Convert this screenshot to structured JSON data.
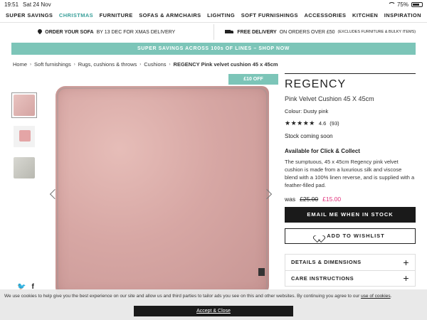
{
  "status_bar": {
    "time": "19:51",
    "date": "Sat 24 Nov",
    "battery": "75%",
    "battery_level": 0.75
  },
  "nav": {
    "items": [
      "SUPER SAVINGS",
      "CHRISTMAS",
      "FURNITURE",
      "SOFAS & ARMCHAIRS",
      "LIGHTING",
      "SOFT FURNISHINGS",
      "ACCESSORIES",
      "KITCHEN",
      "INSPIRATION"
    ],
    "active_color": "#3aa09a"
  },
  "delivery": {
    "left_bold": "ORDER YOUR SOFA",
    "left_text": "BY 13 DEC FOR XMAS DELIVERY",
    "right_bold": "FREE DELIVERY",
    "right_text": "ON ORDERS OVER £50",
    "right_small": "(EXCLUDES FURNITURE & BULKY ITEMS)"
  },
  "promo": {
    "text": "SUPER SAVINGS ACROSS 100s OF LINES – SHOP NOW",
    "color": "#7cc5b8"
  },
  "breadcrumb": [
    "Home",
    "Soft furnishings",
    "Rugs, cushions & throws",
    "Cushions",
    "REGENCY Pink velvet cushion 45 x 45cm"
  ],
  "gallery": {
    "sale_badge": "£10 OFF"
  },
  "product": {
    "brand": "REGENCY",
    "subtitle": "Pink Velvet Cushion 45 X 45cm",
    "colour": "Colour: Dusty pink",
    "stars": "★★★★★",
    "rating": "4.6",
    "review_count": "(93)",
    "stock": "Stock coming soon",
    "availability": "Available for Click & Collect",
    "description": "The sumptuous, 45 x 45cm Regency pink velvet cushion is made from a luxurious silk and viscose blend with a 100% linen reverse, and is supplied with a feather-filled pad.",
    "was_label": "was",
    "was_price": "£25.00",
    "now_price": "£15.00",
    "price_color": "#e0307a",
    "email_button": "EMAIL ME WHEN IN STOCK",
    "wishlist_button": "ADD TO WISHLIST",
    "accordion": [
      "DETAILS & DIMENSIONS",
      "CARE INSTRUCTIONS"
    ]
  },
  "social": {
    "twitter": "🐦",
    "facebook": "f"
  },
  "cookie": {
    "message": "We use cookies to help give you the best experience on our site and allow us and third parties to tailor ads you see on this and other websites. By continuing you agree to our",
    "link": "use of cookies",
    "accept": "Accept & Close"
  }
}
